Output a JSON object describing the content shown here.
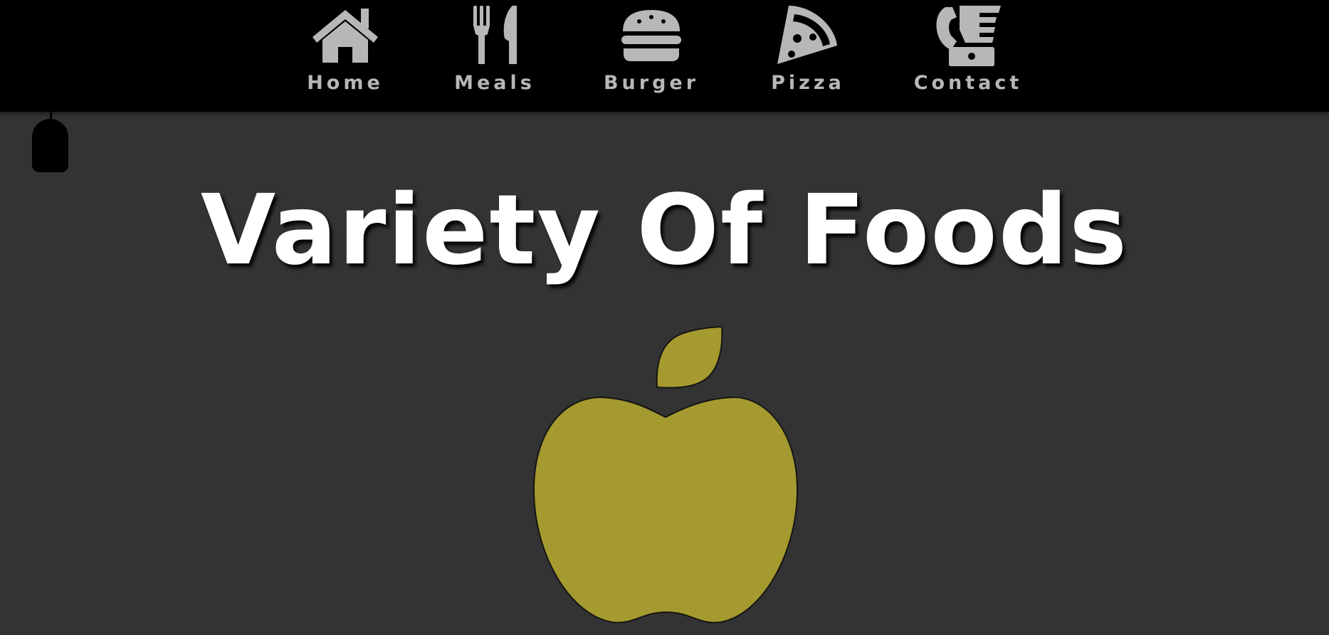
{
  "nav": {
    "items": [
      {
        "label": "Home",
        "icon": "house-icon"
      },
      {
        "label": "Meals",
        "icon": "fork-knife-icon"
      },
      {
        "label": "Burger",
        "icon": "burger-icon"
      },
      {
        "label": "Pizza",
        "icon": "pizza-slice-icon"
      },
      {
        "label": "Contact",
        "icon": "phone-fax-icon"
      }
    ]
  },
  "hero": {
    "title": "Variety Of Foods",
    "image": "apple-icon"
  },
  "colors": {
    "nav_background": "#000000",
    "page_background": "#333333",
    "nav_text": "#b7b7b7",
    "title_text": "#ffffff",
    "apple": "#a59a2f"
  }
}
